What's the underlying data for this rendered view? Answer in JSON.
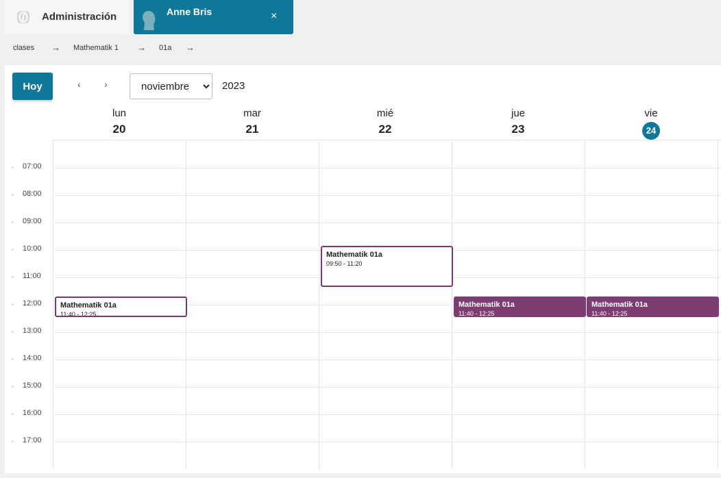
{
  "tabs": {
    "admin": {
      "label": "Administración",
      "icon": "app-logo-icon"
    },
    "user": {
      "name": "Anne Bris",
      "close": "×",
      "icon": "user-avatar-icon"
    }
  },
  "breadcrumb": {
    "items": [
      "clases",
      "Mathematik 1",
      "01a"
    ],
    "separator": "→"
  },
  "toolbar": {
    "today_label": "Hoy",
    "prev": "‹",
    "next": "›",
    "month_selected": "noviembre",
    "year": "2023"
  },
  "days": [
    {
      "name": "lun",
      "num": "20"
    },
    {
      "name": "mar",
      "num": "21"
    },
    {
      "name": "mié",
      "num": "22"
    },
    {
      "name": "jue",
      "num": "23"
    },
    {
      "name": "vie",
      "num": "24",
      "today": true
    }
  ],
  "hours": [
    "07:00",
    "08:00",
    "09:00",
    "10:00",
    "11:00",
    "12:00",
    "13:00",
    "14:00",
    "15:00",
    "16:00",
    "17:00"
  ],
  "events": [
    {
      "title": "Mathematik 01a",
      "time": "11:40 - 12:25",
      "style": "outline"
    },
    {
      "title": "Mathematik 01a",
      "time": "09:50 - 11:20",
      "style": "outline"
    },
    {
      "title": "Mathematik 01a",
      "time": "11:40 - 12:25",
      "style": "filled"
    },
    {
      "title": "Mathematik 01a",
      "time": "11:40 - 12:25",
      "style": "filled"
    }
  ],
  "colors": {
    "accent": "#0f7898",
    "event": "#7e3d72"
  }
}
